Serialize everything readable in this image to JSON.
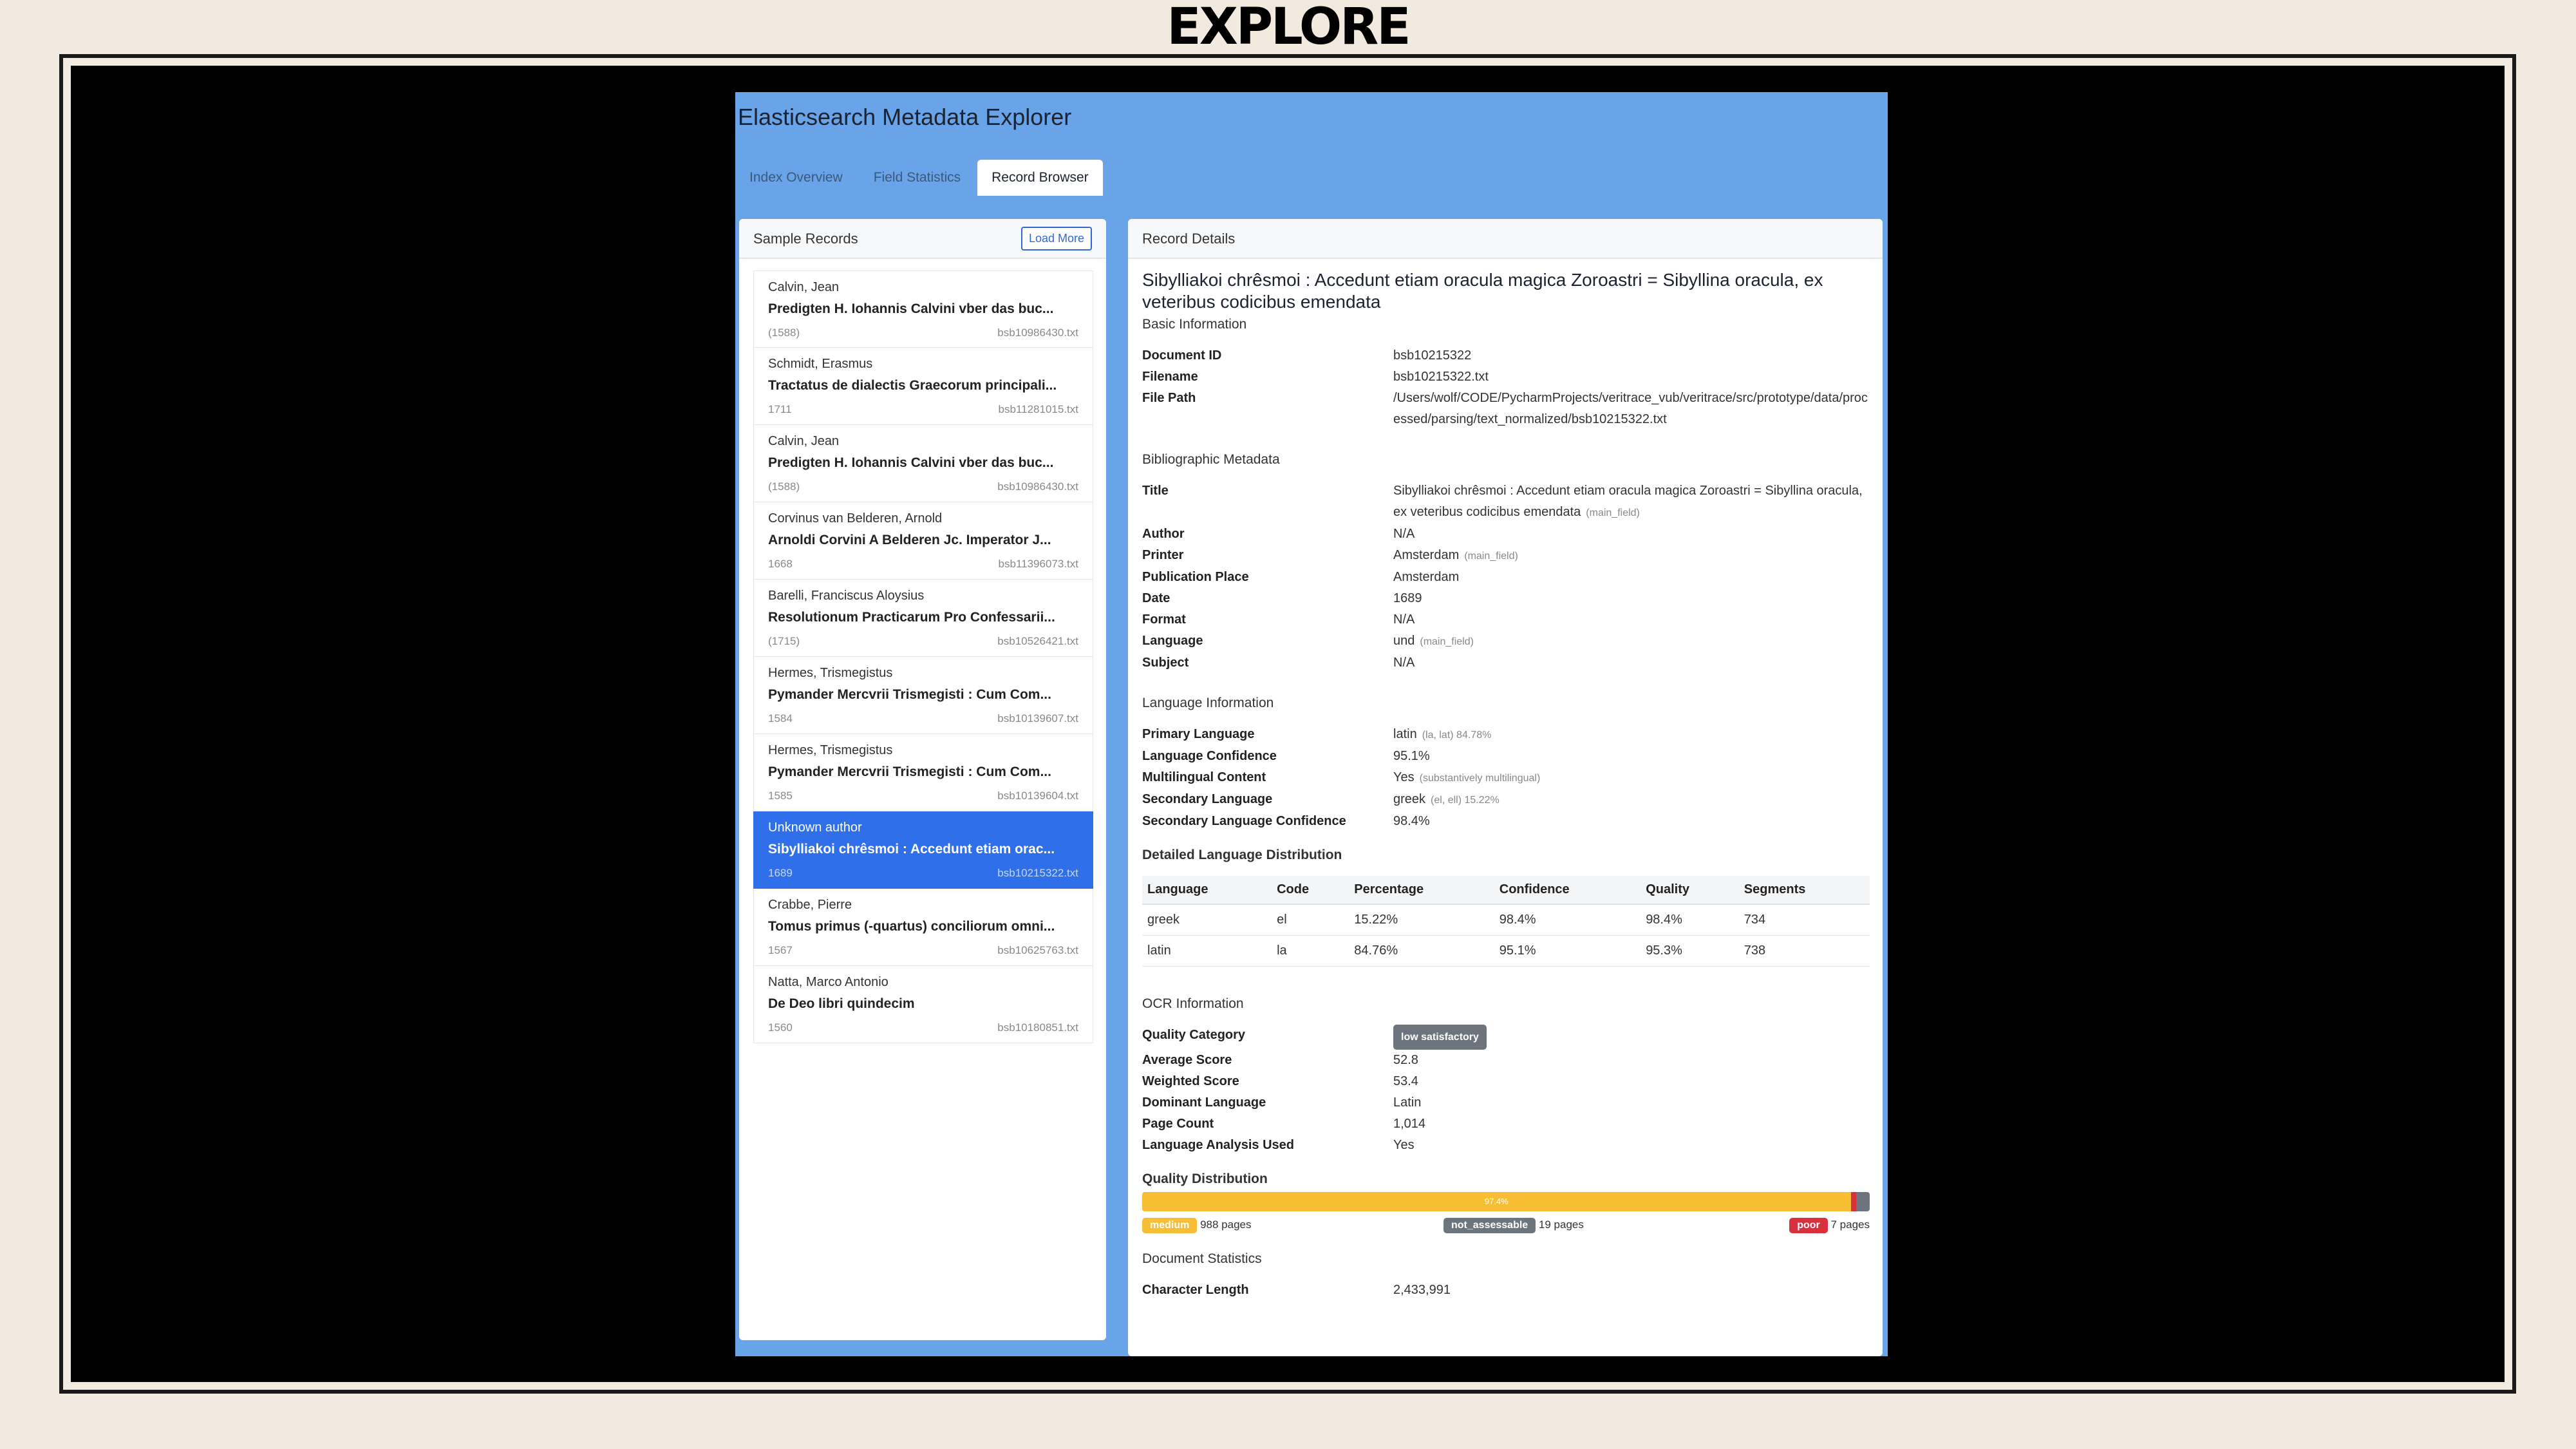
{
  "slide_title": "EXPLORE",
  "app": {
    "title": "Elasticsearch Metadata Explorer",
    "tabs": [
      {
        "label": "Index Overview",
        "active": false
      },
      {
        "label": "Field Statistics",
        "active": false
      },
      {
        "label": "Record Browser",
        "active": true
      }
    ]
  },
  "sample_records": {
    "header": "Sample Records",
    "load_more": "Load More",
    "items": [
      {
        "author": "Calvin, Jean",
        "title": "Predigten H. Iohannis Calvini vber das buc...",
        "date": "(1588)",
        "file": "bsb10986430.txt"
      },
      {
        "author": "Schmidt, Erasmus",
        "title": "Tractatus de dialectis Graecorum principali...",
        "date": "1711",
        "file": "bsb11281015.txt"
      },
      {
        "author": "Calvin, Jean",
        "title": "Predigten H. Iohannis Calvini vber das buc...",
        "date": "(1588)",
        "file": "bsb10986430.txt"
      },
      {
        "author": "Corvinus van Belderen, Arnold",
        "title": "Arnoldi Corvini A Belderen Jc. Imperator J...",
        "date": "1668",
        "file": "bsb11396073.txt"
      },
      {
        "author": "Barelli, Franciscus Aloysius",
        "title": "Resolutionum Practicarum Pro Confessarii...",
        "date": "(1715)",
        "file": "bsb10526421.txt"
      },
      {
        "author": "Hermes, Trismegistus",
        "title": "Pymander Mercvrii Trismegisti : Cum Com...",
        "date": "1584",
        "file": "bsb10139607.txt"
      },
      {
        "author": "Hermes, Trismegistus",
        "title": "Pymander Mercvrii Trismegisti : Cum Com...",
        "date": "1585",
        "file": "bsb10139604.txt"
      },
      {
        "author": "Unknown author",
        "title": "Sibylliakoi chrêsmoi : Accedunt etiam orac...",
        "date": "1689",
        "file": "bsb10215322.txt",
        "selected": true
      },
      {
        "author": "Crabbe, Pierre",
        "title": "Tomus primus (-quartus) conciliorum omni...",
        "date": "1567",
        "file": "bsb10625763.txt"
      },
      {
        "author": "Natta, Marco Antonio",
        "title": "De Deo libri quindecim",
        "date": "1560",
        "file": "bsb10180851.txt"
      }
    ]
  },
  "record_details": {
    "header": "Record Details",
    "title": "Sibylliakoi chrêsmoi : Accedunt etiam oracula magica Zoroastri = Sibyllina oracula, ex veteribus codicibus emendata",
    "basic_info": {
      "heading": "Basic Information",
      "document_id_label": "Document ID",
      "document_id": "bsb10215322",
      "filename_label": "Filename",
      "filename": "bsb10215322.txt",
      "file_path_label": "File Path",
      "file_path": "/Users/wolf/CODE/PycharmProjects/veritrace_vub/veritrace/src/prototype/data/processed/parsing/text_normalized/bsb10215322.txt"
    },
    "bibliographic": {
      "heading": "Bibliographic Metadata",
      "title_label": "Title",
      "title": "Sibylliakoi chrêsmoi : Accedunt etiam oracula magica Zoroastri = Sibyllina oracula, ex veteribus codicibus emendata",
      "title_note": "(main_field)",
      "author_label": "Author",
      "author": "N/A",
      "printer_label": "Printer",
      "printer": "Amsterdam",
      "printer_note": "(main_field)",
      "place_label": "Publication Place",
      "place": "Amsterdam",
      "date_label": "Date",
      "date": "1689",
      "format_label": "Format",
      "format": "N/A",
      "language_label": "Language",
      "language": "und",
      "language_note": "(main_field)",
      "subject_label": "Subject",
      "subject": "N/A"
    },
    "language_info": {
      "heading": "Language Information",
      "primary_label": "Primary Language",
      "primary": "latin",
      "primary_note": "(la, lat) 84.78%",
      "confidence_label": "Language Confidence",
      "confidence": "95.1%",
      "multilingual_label": "Multilingual Content",
      "multilingual": "Yes",
      "multilingual_note": "(substantively multilingual)",
      "secondary_label": "Secondary Language",
      "secondary": "greek",
      "secondary_note": "(el, ell) 15.22%",
      "secondary_conf_label": "Secondary Language Confidence",
      "secondary_conf": "98.4%"
    },
    "distribution": {
      "heading": "Detailed Language Distribution",
      "columns": [
        "Language",
        "Code",
        "Percentage",
        "Confidence",
        "Quality",
        "Segments"
      ],
      "rows": [
        [
          "greek",
          "el",
          "15.22%",
          "98.4%",
          "98.4%",
          "734"
        ],
        [
          "latin",
          "la",
          "84.76%",
          "95.1%",
          "95.3%",
          "738"
        ]
      ]
    },
    "ocr": {
      "heading": "OCR Information",
      "quality_category_label": "Quality Category",
      "quality_category": "low satisfactory",
      "average_label": "Average Score",
      "average": "52.8",
      "weighted_label": "Weighted Score",
      "weighted": "53.4",
      "dominant_label": "Dominant Language",
      "dominant": "Latin",
      "pages_label": "Page Count",
      "pages": "1,014",
      "analysis_label": "Language Analysis Used",
      "analysis": "Yes"
    },
    "quality_distribution": {
      "heading": "Quality Distribution",
      "medium_fraction": 0.974,
      "poor_fraction": 0.007,
      "not_assessable_fraction": 0.019,
      "bar_label": "97.4%",
      "medium_badge": "medium",
      "medium_pages": "988 pages",
      "na_badge": "not_assessable",
      "na_pages": "19 pages",
      "poor_badge": "poor",
      "poor_pages": "7 pages",
      "colors": {
        "medium": "#f7bd35",
        "poor": "#d9303e",
        "not_assessable": "#6c757d"
      }
    },
    "doc_stats": {
      "heading": "Document Statistics",
      "char_len_label": "Character Length",
      "char_len": "2,433,991"
    }
  }
}
